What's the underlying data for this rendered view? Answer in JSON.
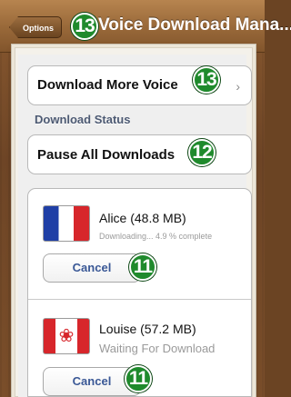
{
  "nav": {
    "back_label": "Options",
    "title": "Voice Download Mana...",
    "badge": "13"
  },
  "download_more": {
    "label": "Download More Voice",
    "badge": "13"
  },
  "section_header": "Download Status",
  "pause_all": {
    "label": "Pause All Downloads",
    "badge": "12"
  },
  "downloads": [
    {
      "name": "Alice (48.8 MB)",
      "status": "Downloading... 4.9 % complete",
      "flag": "france-flag",
      "cancel_label": "Cancel",
      "badge": "11"
    },
    {
      "name": "Louise (57.2 MB)",
      "status": "Waiting For Download",
      "flag": "canada-flag",
      "cancel_label": "Cancel",
      "badge": "11"
    }
  ],
  "colors": {
    "nav_wood": "#9a6a3a",
    "badge_green": "#1f8a2c",
    "link_blue": "#3a5896",
    "section_text": "#4d5a73"
  }
}
